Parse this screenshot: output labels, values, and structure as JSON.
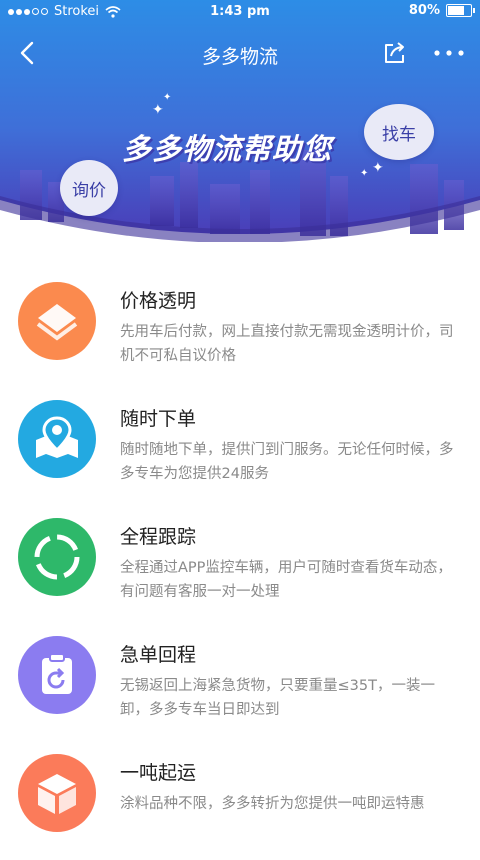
{
  "status_bar": {
    "carrier": "Strokei",
    "time": "1:43 pm",
    "battery": "80%",
    "battery_level": 0.8
  },
  "nav": {
    "title": "多多物流"
  },
  "hero": {
    "title": "多多物流帮助您",
    "bubble_right": "找车",
    "bubble_left": "询价"
  },
  "features": [
    {
      "title": "价格透明",
      "desc": "先用车后付款，网上直接付款无需现金透明计价，司机不可私自议价格",
      "icon": "layers-icon",
      "color": "#fb8a4e"
    },
    {
      "title": "随时下单",
      "desc": "随时随地下单，提供门到门服务。无论任何时候，多多专车为您提供24服务",
      "icon": "map-pin-icon",
      "color": "#23a9e1"
    },
    {
      "title": "全程跟踪",
      "desc": "全程通过APP监控车辆，用户可随时查看货车动态，有问题有客服一对一处理",
      "icon": "tracking-ring-icon",
      "color": "#2eb86a"
    },
    {
      "title": "急单回程",
      "desc": "无锡返回上海紧急货物，只要重量≤35T，一装一卸，多多专车当日即达到",
      "icon": "return-clipboard-icon",
      "color": "#8b7cf0"
    },
    {
      "title": "一吨起运",
      "desc": "涂料品种不限，多多转折为您提供一吨即运特惠",
      "icon": "box-icon",
      "color": "#fb7b5a"
    }
  ]
}
